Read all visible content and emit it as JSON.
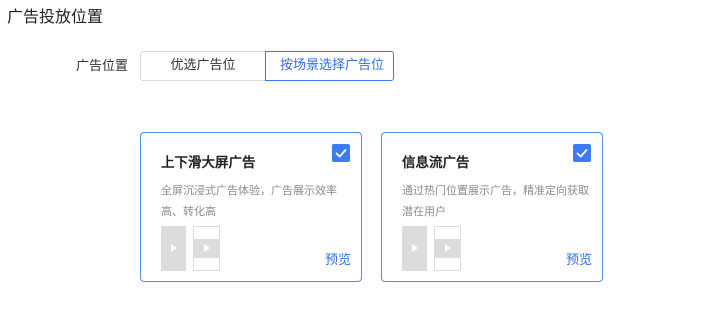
{
  "section": {
    "title": "广告投放位置"
  },
  "placement": {
    "label": "广告位置",
    "options": [
      "优选广告位",
      "按场景选择广告位"
    ],
    "selected": "按场景选择广告位"
  },
  "cards": [
    {
      "title": "上下滑大屏广告",
      "description": "全屏沉浸式广告体验，广告展示效率高、转化高",
      "checked": true,
      "preview_label": "预览"
    },
    {
      "title": "信息流广告",
      "description": "通过热门位置展示广告，精准定向获取潜在用户",
      "checked": true,
      "preview_label": "预览"
    }
  ],
  "colors": {
    "accent": "#3b7cf2",
    "card_border": "#4f8ef2",
    "muted_text": "#8c8c8c",
    "thumb_gray": "#dcdcdc"
  },
  "icons": {
    "check": "check-icon",
    "play": "play-icon"
  }
}
